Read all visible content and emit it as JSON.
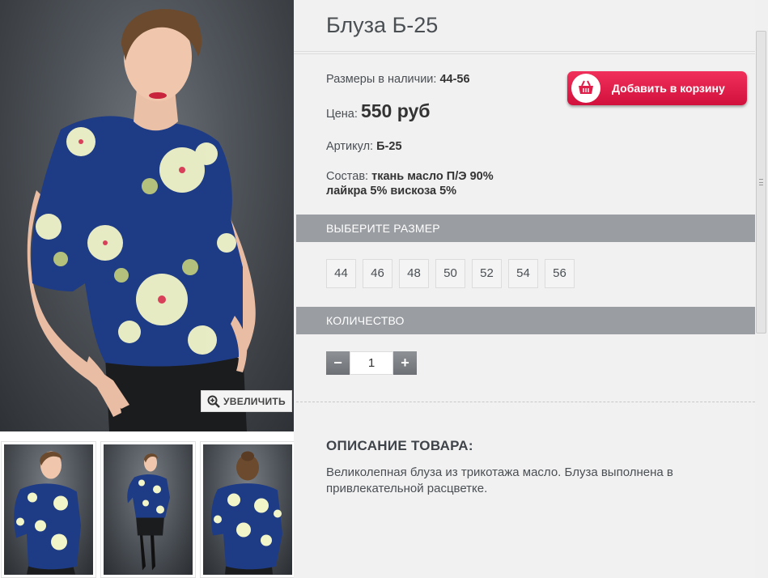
{
  "product": {
    "title": "Блуза Б-25",
    "sizes_label": "Размеры в наличии:",
    "sizes_value": "44-56",
    "price_label": "Цена:",
    "price_value": "550 руб",
    "article_label": "Артикул:",
    "article_value": "Б-25",
    "composition_label": "Состав:",
    "composition_line1": "ткань масло П/Э 90%",
    "composition_line2": "лайкра 5% вискоза 5%"
  },
  "gallery": {
    "zoom_label": "УВЕЛИЧИТЬ"
  },
  "cart": {
    "button_label": "Добавить в корзину",
    "icon": "basket-icon",
    "color": "#e01e4a"
  },
  "size_section": {
    "title": "ВЫБЕРИТЕ РАЗМЕР",
    "options": [
      "44",
      "46",
      "48",
      "50",
      "52",
      "54",
      "56"
    ]
  },
  "quantity_section": {
    "title": "КОЛИЧЕСТВО",
    "minus": "−",
    "value": "1",
    "plus": "+"
  },
  "description": {
    "title": "ОПИСАНИЕ ТОВАРА:",
    "text": "Великолепная блуза из трикотажа масло. Блуза выполнена в привлекательной расцветке."
  }
}
